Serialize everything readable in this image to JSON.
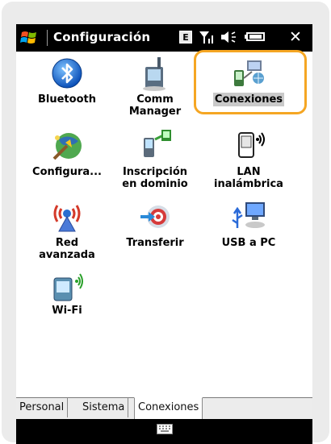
{
  "title_bar": {
    "title": "Configuración",
    "status_letter": "E",
    "close_label": "✕"
  },
  "apps": [
    {
      "label": "Bluetooth",
      "icon": "bluetooth-icon"
    },
    {
      "label": "Comm\nManager",
      "icon": "comm-manager-icon"
    },
    {
      "label": "Conexiones",
      "icon": "connections-icon",
      "selected": true
    },
    {
      "label": "Configura...",
      "icon": "configure-icon"
    },
    {
      "label": "Inscripción\nen dominio",
      "icon": "domain-enroll-icon"
    },
    {
      "label": "LAN\ninalámbrica",
      "icon": "wireless-lan-icon"
    },
    {
      "label": "Red\navanzada",
      "icon": "advanced-network-icon"
    },
    {
      "label": "Transferir",
      "icon": "transfer-icon"
    },
    {
      "label": "USB a PC",
      "icon": "usb-to-pc-icon"
    },
    {
      "label": "Wi-Fi",
      "icon": "wifi-icon"
    }
  ],
  "tabs": [
    {
      "label": "Personal"
    },
    {
      "label": "Sistema"
    },
    {
      "label": "Conexiones",
      "active": true
    }
  ],
  "colors": {
    "highlight": "#f5a623",
    "titlebar": "#000000"
  }
}
